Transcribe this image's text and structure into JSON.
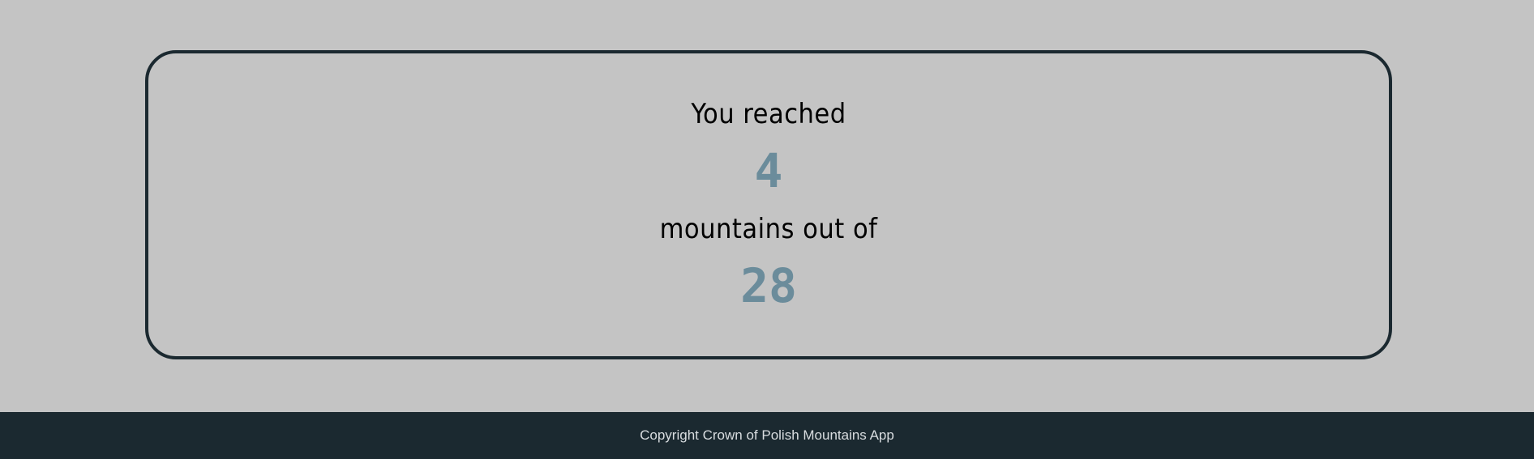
{
  "summary": {
    "reached_label": "You reached",
    "reached_count": "4",
    "out_of_label": "mountains out of",
    "total_count": "28"
  },
  "footer": {
    "copyright": "Copyright Crown of Polish Mountains App"
  },
  "colors": {
    "background": "#c4c4c4",
    "dark": "#1b2930",
    "accent": "#6b8c9b"
  }
}
